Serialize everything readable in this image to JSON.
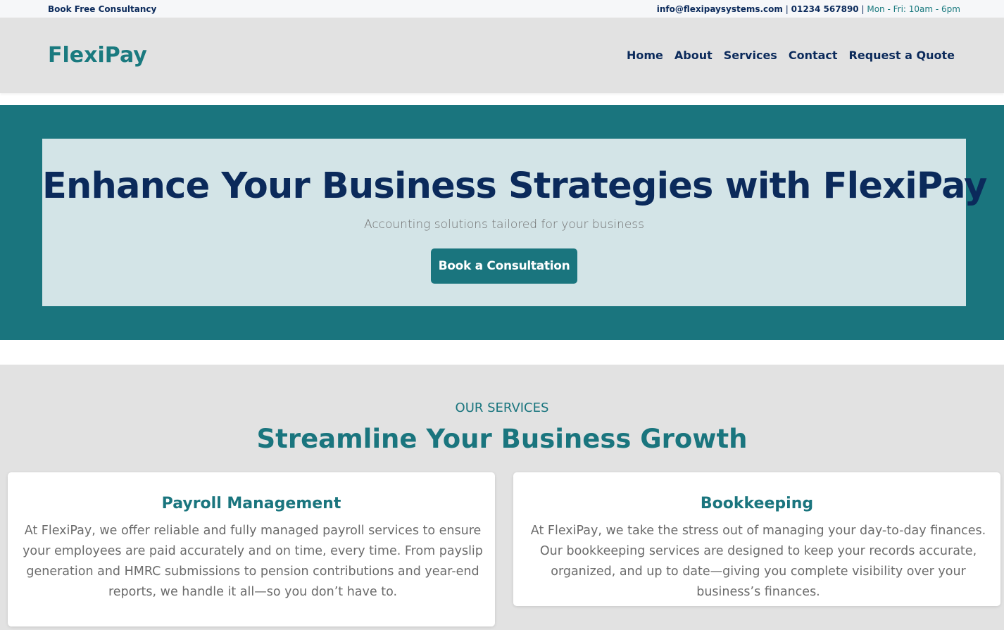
{
  "topbar": {
    "left_link": "Book Free Consultancy",
    "email": "info@flexipaysystems.com",
    "phone": "01234 567890",
    "hours": "Mon - Fri: 10am - 6pm",
    "separator": "|"
  },
  "header": {
    "brand": "FlexiPay",
    "nav": [
      "Home",
      "About",
      "Services",
      "Contact",
      "Request a Quote"
    ]
  },
  "hero": {
    "title": "Enhance Your Business Strategies with FlexiPay",
    "subtitle": "Accounting solutions tailored for your business",
    "cta_label": "Book a Consultation"
  },
  "services": {
    "eyebrow": "OUR SERVICES",
    "title": "Streamline Your Business Growth",
    "cards": [
      {
        "title": "Payroll Management",
        "text": "At FlexiPay, we offer reliable and fully managed payroll services to ensure your employees are paid accurately and on time, every time. From payslip generation and HMRC submissions to pension contributions and year-end reports, we handle it all—so you don’t have to."
      },
      {
        "title": "Bookkeeping",
        "text": "At FlexiPay, we take the stress out of managing your day-to-day finances. Our bookkeeping services are designed to keep your records accurate, organized, and up to date—giving you complete visibility over your business’s finances."
      }
    ]
  },
  "colors": {
    "teal": "#1a757e",
    "navy": "#0b2a5b",
    "hero_card": "#d3e4e7",
    "header_bg": "#e2e2e2"
  }
}
